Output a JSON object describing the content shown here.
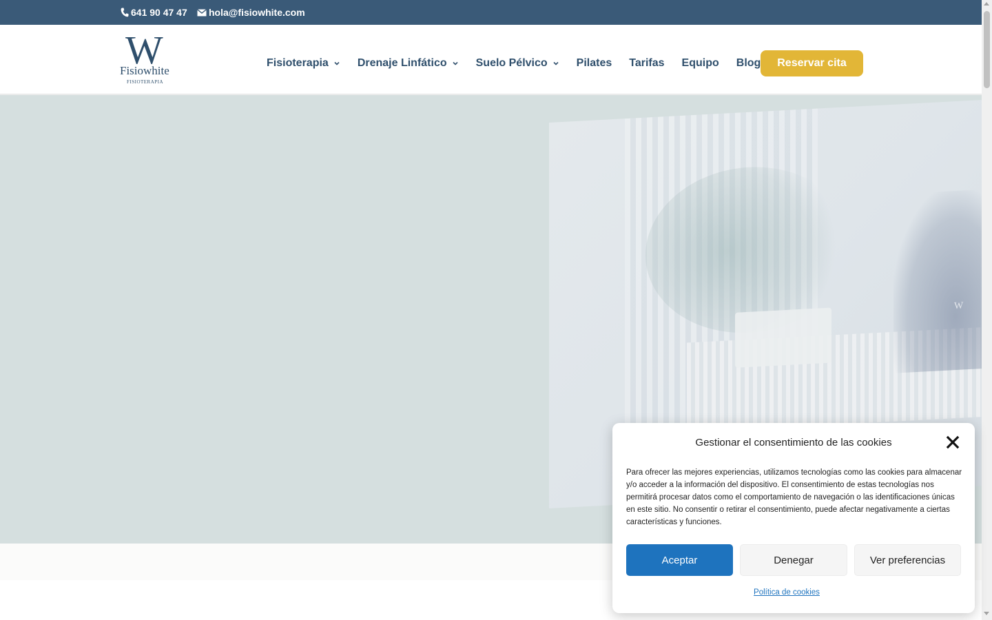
{
  "topbar": {
    "phone": "641 90 47 47",
    "email": "hola@fisiowhite.com"
  },
  "logo": {
    "monogram": "W",
    "brand": "Fisiowhite",
    "subtitle": "FISIOTERAPIA"
  },
  "nav": {
    "items": [
      {
        "label": "Fisioterapia",
        "has_dropdown": true
      },
      {
        "label": "Drenaje Linfático",
        "has_dropdown": true
      },
      {
        "label": "Suelo Pélvico",
        "has_dropdown": true
      },
      {
        "label": "Pilates",
        "has_dropdown": false
      },
      {
        "label": "Tarifas",
        "has_dropdown": false
      },
      {
        "label": "Equipo",
        "has_dropdown": false
      },
      {
        "label": "Blog",
        "has_dropdown": false
      }
    ],
    "cta_label": "Reservar cita"
  },
  "hero": {
    "photo_mark": "W"
  },
  "cookie": {
    "title": "Gestionar el consentimiento de las cookies",
    "text": "Para ofrecer las mejores experiencias, utilizamos tecnologías como las cookies para almacenar y/o acceder a la información del dispositivo. El consentimiento de estas tecnologías nos permitirá procesar datos como el comportamiento de navegación o las identificaciones únicas en este sitio. No consentir o retirar el consentimiento, puede afectar negativamente a ciertas características y funciones.",
    "accept_label": "Aceptar",
    "deny_label": "Denegar",
    "prefs_label": "Ver preferencias",
    "policy_label": "Política de cookies"
  },
  "colors": {
    "topbar": "#3a5a78",
    "nav_text": "#2f4f6c",
    "cta": "#e2b637",
    "accept": "#1e73be",
    "hero_bg": "#d5dfdf"
  },
  "icons": {
    "phone": "phone-icon",
    "email": "envelope-icon",
    "dropdown": "chevron-down-icon",
    "close": "close-icon"
  }
}
